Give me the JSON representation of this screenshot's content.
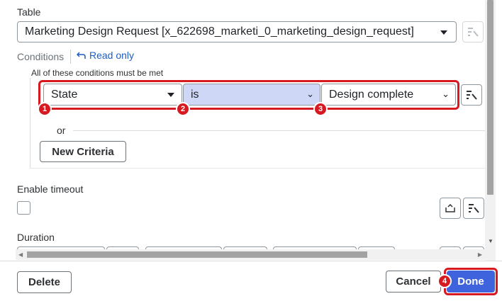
{
  "table": {
    "label": "Table",
    "value": "Marketing Design Request [x_622698_marketi_0_marketing_design_request]"
  },
  "conditions": {
    "label": "Conditions",
    "read_only": "Read only",
    "must_be_met": "All of these conditions must be met",
    "field": "State",
    "operator": "is",
    "value": "Design complete",
    "or_label": "or",
    "new_criteria": "New Criteria"
  },
  "badges": [
    "1",
    "2",
    "3",
    "4"
  ],
  "enable_timeout": {
    "label": "Enable timeout",
    "checked": false
  },
  "duration": {
    "label": "Duration"
  },
  "footer": {
    "delete": "Delete",
    "cancel": "Cancel",
    "done": "Done"
  },
  "colors": {
    "highlight": "#d71921",
    "operator_bg": "#cfd7f7",
    "done_bg": "#3e63dd",
    "link": "#1b5fc1"
  }
}
